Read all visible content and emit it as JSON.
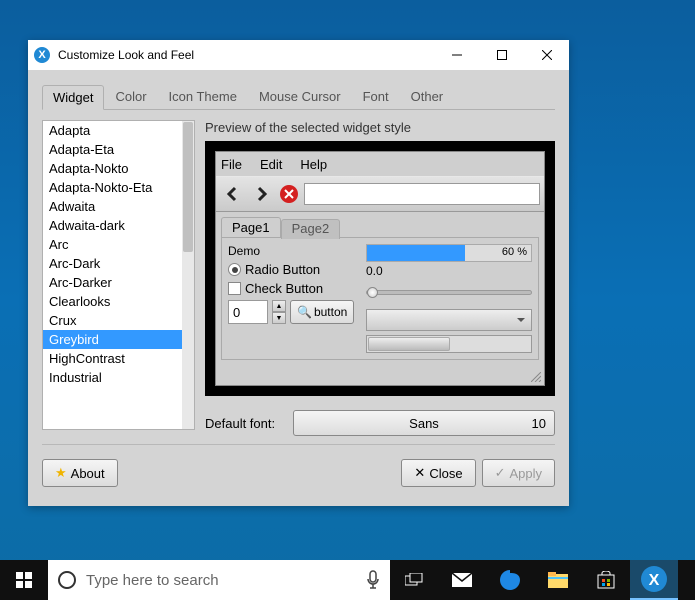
{
  "window": {
    "title": "Customize Look and Feel"
  },
  "tabs": {
    "widget": "Widget",
    "color": "Color",
    "icon": "Icon Theme",
    "mouse": "Mouse Cursor",
    "font": "Font",
    "other": "Other"
  },
  "themes": [
    "Adapta",
    "Adapta-Eta",
    "Adapta-Nokto",
    "Adapta-Nokto-Eta",
    "Adwaita",
    "Adwaita-dark",
    "Arc",
    "Arc-Dark",
    "Arc-Darker",
    "Clearlooks",
    "Crux",
    "Greybird",
    "HighContrast",
    "Industrial"
  ],
  "selected_theme": "Greybird",
  "preview": {
    "label": "Preview of the selected widget style",
    "menu": {
      "file": "File",
      "edit": "Edit",
      "help": "Help"
    },
    "tabs": {
      "p1": "Page1",
      "p2": "Page2"
    },
    "demo_label": "Demo",
    "radio_label": "Radio Button",
    "check_label": "Check Button",
    "spin_value": "0",
    "button_label": "button",
    "progress_text": "60 %",
    "slider_value": "0.0"
  },
  "font": {
    "label": "Default font:",
    "family": "Sans",
    "size": "10"
  },
  "buttons": {
    "about": "About",
    "close": "Close",
    "apply": "Apply"
  },
  "taskbar": {
    "search_placeholder": "Type here to search"
  }
}
